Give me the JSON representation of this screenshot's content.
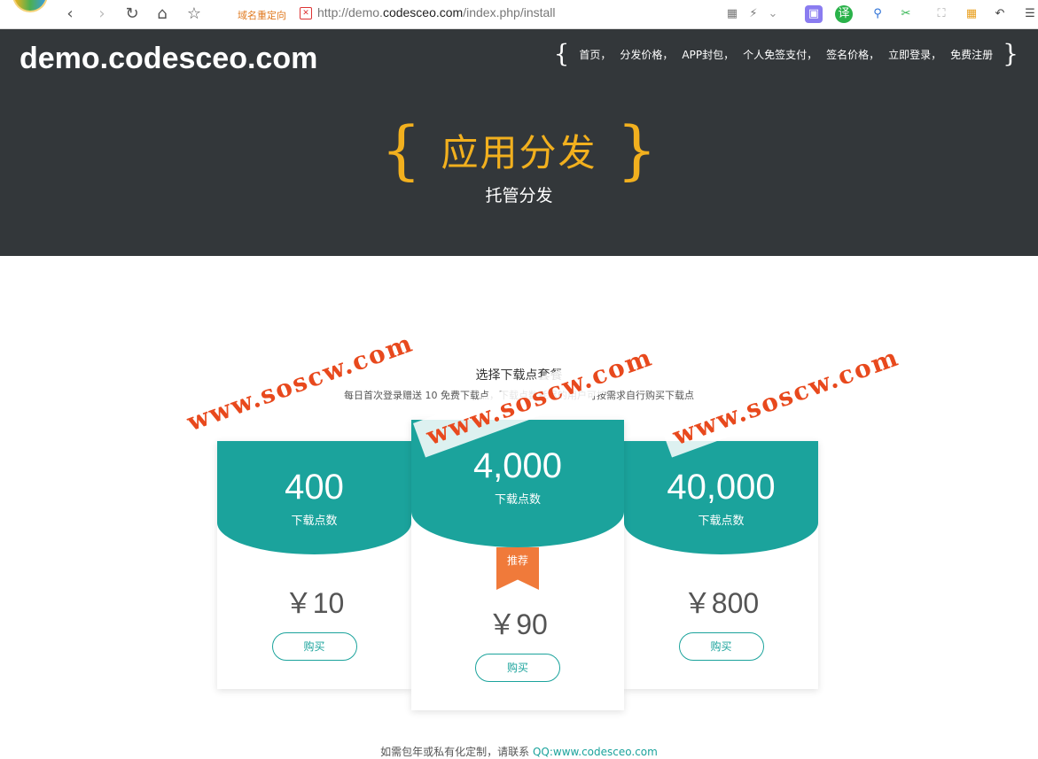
{
  "browser": {
    "redirect_label": "域名重定向",
    "url_prefix": "http://demo.",
    "url_domain": "codesceo.com",
    "url_path": "/index.php/install"
  },
  "header": {
    "site_title": "demo.codesceo.com",
    "nav_open_brace": "{",
    "nav_close_brace": "}",
    "nav": [
      "首页，",
      "分发价格，",
      "APP封包，",
      "个人免签支付，",
      "签名价格，",
      "立即登录，",
      "免费注册"
    ]
  },
  "hero": {
    "brace_left": "{",
    "brace_right": "}",
    "title": "应用分发",
    "subtitle": "托管分发"
  },
  "section": {
    "title": "选择下载点套餐",
    "desc": "每日首次登录赠送 10 免费下载点，下载点数耗尽的用户可按需求自行购买下载点"
  },
  "cards": [
    {
      "points": "400",
      "label": "下载点数",
      "price": "￥10",
      "button": "购买"
    },
    {
      "points": "4,000",
      "label": "下载点数",
      "badge": "推荐",
      "price": "￥90",
      "button": "购买"
    },
    {
      "points": "40,000",
      "label": "下载点数",
      "price": "￥800",
      "button": "购买"
    }
  ],
  "footer": {
    "text": "如需包年或私有化定制，请联系 ",
    "link": "QQ:www.codesceo.com"
  },
  "watermark": "www.soscw.com",
  "colors": {
    "accent": "#1ba39c",
    "header_bg": "#33373a",
    "brace": "#f2b01e",
    "badge": "#f07a3a",
    "watermark": "#e8491d"
  }
}
